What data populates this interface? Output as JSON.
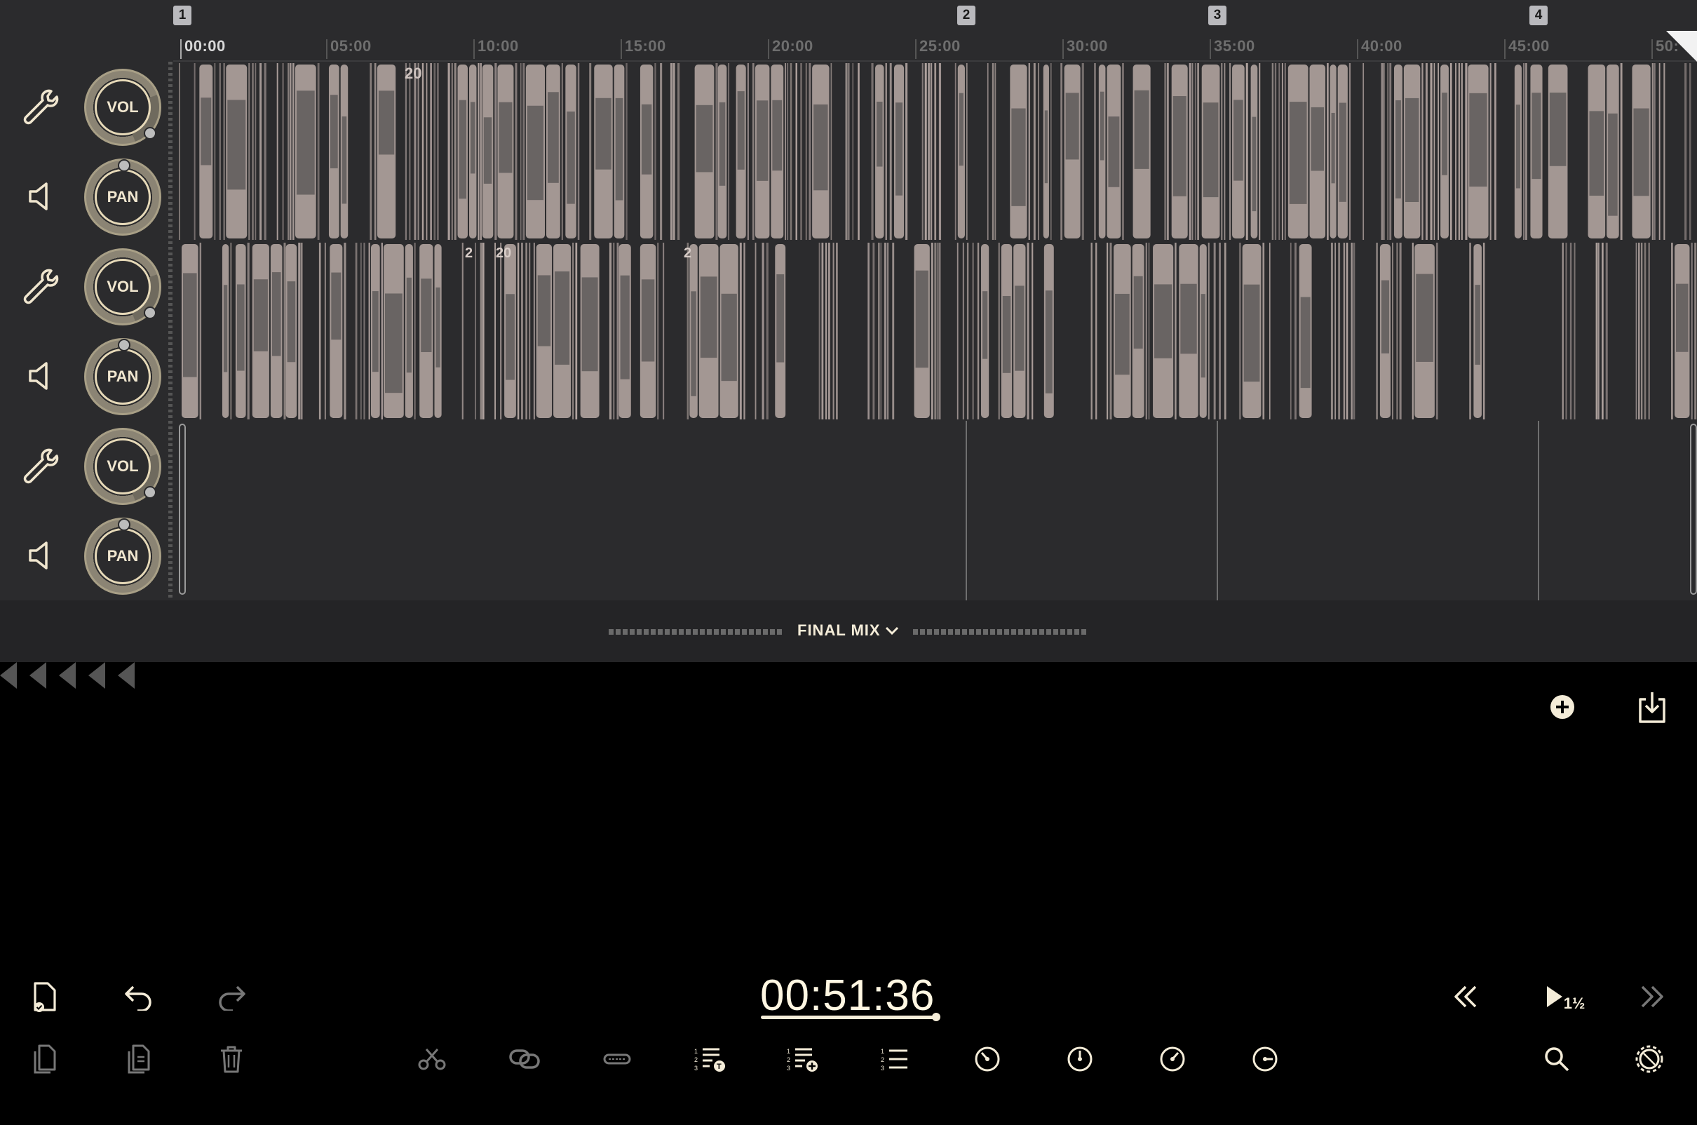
{
  "ruler": {
    "ticks": [
      "00:00",
      "05:00",
      "10:00",
      "15:00",
      "20:00",
      "25:00",
      "30:00",
      "35:00",
      "40:00",
      "45:00",
      "50:"
    ],
    "markers": [
      "1",
      "2",
      "3",
      "4"
    ]
  },
  "tracks": [
    {
      "vol_label": "VOL",
      "pan_label": "PAN",
      "region_labels": [
        "20"
      ]
    },
    {
      "vol_label": "VOL",
      "pan_label": "PAN",
      "region_labels": [
        "2",
        "20",
        "2"
      ]
    },
    {
      "vol_label": "VOL",
      "pan_label": "PAN",
      "region_labels": []
    }
  ],
  "mix": {
    "label": "FINAL MIX"
  },
  "transport": {
    "timecode": "00:51:36",
    "play_speed": "1½"
  },
  "colors": {
    "accent": "#f0e6cf",
    "waveform": "#b8aaa6",
    "panel": "#2b2b2d",
    "background": "#000000"
  },
  "icons": {
    "track_settings": "wrench-icon",
    "track_speaker": "speaker-icon",
    "add": "plus-circle-icon",
    "export": "download-icon"
  }
}
